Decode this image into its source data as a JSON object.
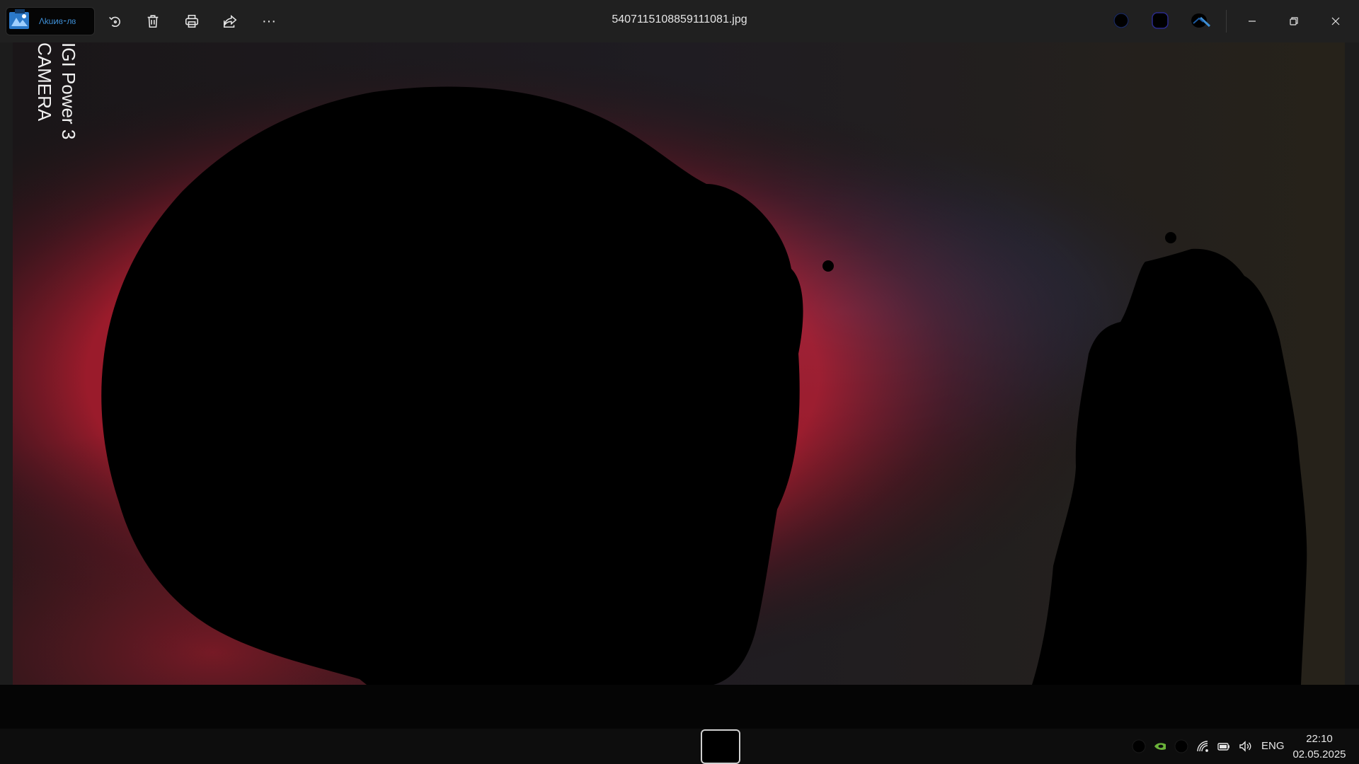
{
  "app": {
    "chip_label": "Ʌkuͷɞ⁃лɞ",
    "file_name": "5407115108859111081.jpg"
  },
  "toolbar": {
    "tools": [
      "rotate",
      "delete",
      "print",
      "share",
      "more"
    ],
    "more_label": "···"
  },
  "window_controls": {
    "minimize": "minimize",
    "maximize": "maximize",
    "close": "close"
  },
  "photo": {
    "watermark_line1": "IGI Power 3",
    "watermark_line2": "CAMERA"
  },
  "taskbar": {
    "language": "ENG",
    "time": "22:10",
    "date": "02.05.2025"
  },
  "colors": {
    "titlebar": "#202020",
    "taskbar": "#0d0d0d",
    "accent": "#3e8fd6",
    "red_glow": "#c1202f",
    "blue_glow": "#4b5aa0"
  }
}
